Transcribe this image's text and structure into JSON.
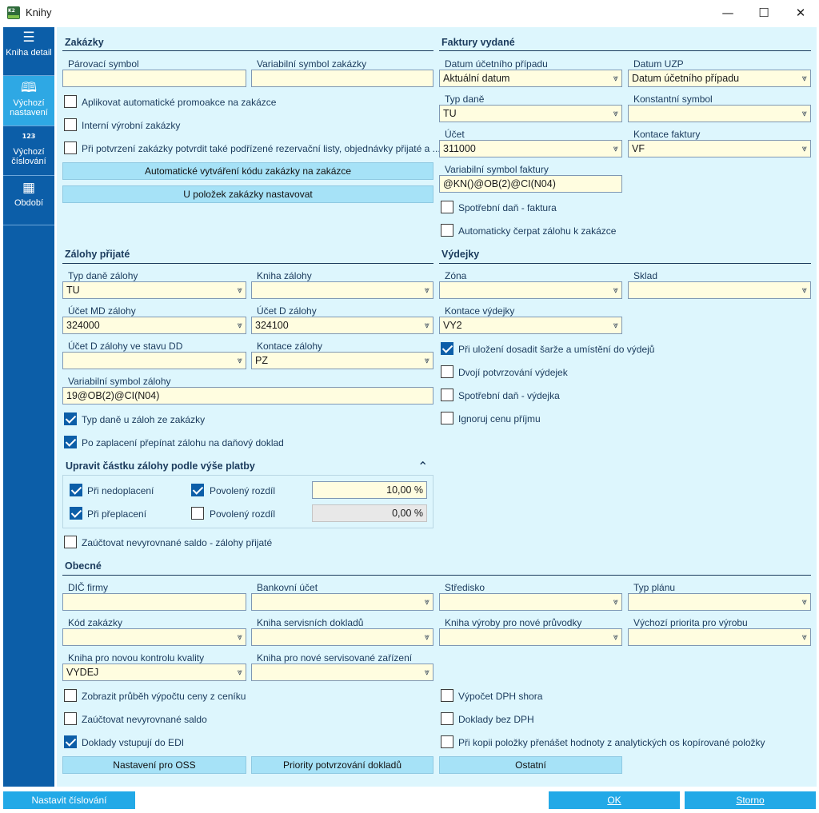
{
  "window": {
    "title": "Knihy",
    "app_icon_text": "K2",
    "minimize": "—",
    "maximize": "☐",
    "close": "✕"
  },
  "sidebar": {
    "items": [
      {
        "label": "Kniha detail",
        "icon": "menu-lines-icon"
      },
      {
        "label": "Výchozí nastavení",
        "icon": "book-icon"
      },
      {
        "label": "Výchozí číslování",
        "icon": "numbering-icon",
        "icon_text": "123"
      },
      {
        "label": "Období",
        "icon": "calendar-icon"
      }
    ]
  },
  "zakazky": {
    "title": "Zakázky",
    "parovaci_symbol": {
      "label": "Párovací symbol",
      "value": ""
    },
    "variabilni_symbol_zakazky": {
      "label": "Variabilní symbol zakázky",
      "value": ""
    },
    "cb_promoakce": {
      "label": "Aplikovat automatické promoakce na zakázce",
      "checked": false
    },
    "cb_interni": {
      "label": "Interní výrobní zakázky",
      "checked": false
    },
    "cb_potvrzeni": {
      "label": "Při potvrzení zakázky potvrdit také podřízené rezervační listy, objednávky přijaté a ...",
      "checked": false
    },
    "btn_auto_kod": "Automatické vytváření kódu zakázky na zakázce",
    "btn_polozky": "U položek zakázky nastavovat"
  },
  "faktury": {
    "title": "Faktury vydané",
    "datum_ucetniho_pripadu": {
      "label": "Datum účetního případu",
      "value": "Aktuální datum"
    },
    "datum_uzp": {
      "label": "Datum UZP",
      "value": "Datum účetního případu"
    },
    "typ_dane": {
      "label": "Typ daně",
      "value": "TU"
    },
    "konstantni_symbol": {
      "label": "Konstantní symbol",
      "value": ""
    },
    "ucet": {
      "label": "Účet",
      "value": "311000"
    },
    "kontace_faktury": {
      "label": "Kontace faktury",
      "value": "VF"
    },
    "variabilni_symbol_faktury": {
      "label": "Variabilní symbol faktury",
      "value": "@KN()@OB(2)@CI(N04)"
    },
    "cb_spotrebni_dan": {
      "label": "Spotřební daň - faktura",
      "checked": false
    },
    "cb_cerpat_zalohu": {
      "label": "Automaticky čerpat zálohu k zakázce",
      "checked": false
    }
  },
  "zalohy": {
    "title": "Zálohy přijaté",
    "typ_dane_zalohy": {
      "label": "Typ daně zálohy",
      "value": "TU"
    },
    "kniha_zalohy": {
      "label": "Kniha zálohy",
      "value": ""
    },
    "ucet_md_zalohy": {
      "label": "Účet MD zálohy",
      "value": "324000"
    },
    "ucet_d_zalohy": {
      "label": "Účet D zálohy",
      "value": "324100"
    },
    "ucet_d_dd": {
      "label": "Účet D zálohy ve stavu DD",
      "value": ""
    },
    "kontace_zalohy": {
      "label": "Kontace zálohy",
      "value": "PZ"
    },
    "variabilni_symbol_zalohy": {
      "label": "Variabilní symbol zálohy",
      "value": "19@OB(2)@CI(N04)"
    },
    "cb_typ_dane_ze_zakazky": {
      "label": "Typ daně u záloh ze zakázky",
      "checked": true
    },
    "cb_prepinat": {
      "label": "Po zaplacení přepínat zálohu na daňový doklad",
      "checked": true
    },
    "upravit_title": "Upravit částku zálohy podle výše platby",
    "collapse_icon": "⌃",
    "cb_nedoplaceni": {
      "label": "Při nedoplacení",
      "checked": true
    },
    "cb_povoleny_rozdil_1": {
      "label": "Povolený rozdíl",
      "checked": true
    },
    "rozdil_1": "10,00 %",
    "cb_preplaceni": {
      "label": "Při přeplacení",
      "checked": true
    },
    "cb_povoleny_rozdil_2": {
      "label": "Povolený rozdíl",
      "checked": false
    },
    "rozdil_2": "0,00 %",
    "cb_zauctovat": {
      "label": "Zaúčtovat nevyrovnané saldo - zálohy přijaté",
      "checked": false
    }
  },
  "vydejky": {
    "title": "Výdejky",
    "zona": {
      "label": "Zóna",
      "value": ""
    },
    "sklad": {
      "label": "Sklad",
      "value": ""
    },
    "kontace_vydejky": {
      "label": "Kontace výdejky",
      "value": "VY2"
    },
    "cb_sarze": {
      "label": "Při uložení dosadit šarže a umístění do výdejů",
      "checked": true
    },
    "cb_dvoji": {
      "label": "Dvojí potvrzování výdejek",
      "checked": false
    },
    "cb_spotrebni": {
      "label": "Spotřební daň - výdejka",
      "checked": false
    },
    "cb_ignoruj": {
      "label": "Ignoruj cenu příjmu",
      "checked": false
    }
  },
  "obecne": {
    "title": "Obecné",
    "dic_firmy": {
      "label": "DIČ firmy",
      "value": ""
    },
    "bankovni_ucet": {
      "label": "Bankovní účet",
      "value": ""
    },
    "stredisko": {
      "label": "Středisko",
      "value": ""
    },
    "typ_planu": {
      "label": "Typ plánu",
      "value": ""
    },
    "kod_zakazky": {
      "label": "Kód zakázky",
      "value": ""
    },
    "kniha_servisnich": {
      "label": "Kniha servisních dokladů",
      "value": ""
    },
    "kniha_vyroby": {
      "label": "Kniha výroby pro nové průvodky",
      "value": ""
    },
    "vychozi_priorita": {
      "label": "Výchozí priorita pro výrobu",
      "value": ""
    },
    "kniha_kontrola": {
      "label": "Kniha pro novou kontrolu kvality",
      "value": "VYDEJ"
    },
    "kniha_zarizeni": {
      "label": "Kniha pro nové servisované zařízení",
      "value": ""
    },
    "cb_prubeh": {
      "label": "Zobrazit průběh výpočtu ceny z ceníku",
      "checked": false
    },
    "cb_zauctovat_saldo": {
      "label": "Zaúčtovat nevyrovnané saldo",
      "checked": false
    },
    "cb_edi": {
      "label": "Doklady vstupují do EDI",
      "checked": true
    },
    "cb_dph_shora": {
      "label": "Výpočet DPH shora",
      "checked": false
    },
    "cb_bez_dph": {
      "label": "Doklady bez DPH",
      "checked": false
    },
    "cb_kopie": {
      "label": "Při kopii položky přenášet hodnoty z analytických os kopírované položky",
      "checked": false
    },
    "btn_oss": "Nastavení pro OSS",
    "btn_priority": "Priority potvrzování dokladů",
    "btn_ostatni": "Ostatní"
  },
  "footer": {
    "nastavit_cislovani": "Nastavit číslování",
    "ok": "OK",
    "storno": "Storno"
  },
  "colors": {
    "sidebar": "#0c5ea8",
    "sidebar_active": "#2ea8e4",
    "content_bg": "#ddf6fd",
    "field_bg": "#fffde0",
    "button_bg": "#a6e2f7",
    "footer_button": "#22a9e7"
  },
  "icons": {
    "dropdown": "dropdown-chevron-icon"
  }
}
